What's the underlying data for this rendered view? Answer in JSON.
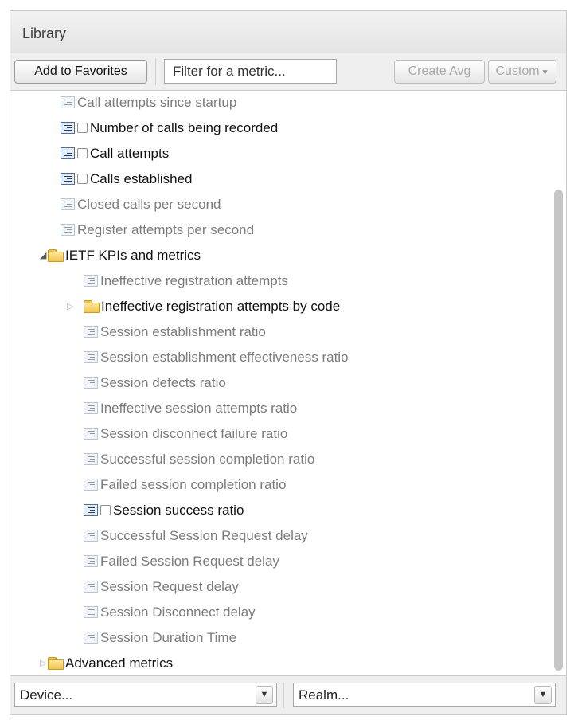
{
  "panel": {
    "title": "Library"
  },
  "toolbar": {
    "add_favorites_label": "Add to Favorites",
    "filter_placeholder": "Filter for a metric...",
    "filter_value": "",
    "create_avg_label": "Create Avg",
    "custom_label": "Custom"
  },
  "tree": {
    "items": [
      {
        "label": "Call attempts since startup",
        "kind": "metric",
        "state": "dim"
      },
      {
        "label": "Number of calls being recorded",
        "kind": "metric",
        "state": "active"
      },
      {
        "label": "Call attempts",
        "kind": "metric",
        "state": "active"
      },
      {
        "label": "Calls established",
        "kind": "metric",
        "state": "active"
      },
      {
        "label": "Closed calls per second",
        "kind": "metric",
        "state": "dim"
      },
      {
        "label": "Register attempts per second",
        "kind": "metric",
        "state": "dim"
      },
      {
        "label": "IETF KPIs and metrics",
        "kind": "folder",
        "expanded": true
      },
      {
        "label": "Ineffective registration attempts",
        "kind": "metric",
        "state": "dim"
      },
      {
        "label": "Ineffective registration attempts by code",
        "kind": "folder",
        "expanded": false
      },
      {
        "label": "Session establishment ratio",
        "kind": "metric",
        "state": "dim"
      },
      {
        "label": "Session establishment effectiveness ratio",
        "kind": "metric",
        "state": "dim"
      },
      {
        "label": "Session defects ratio",
        "kind": "metric",
        "state": "dim"
      },
      {
        "label": "Ineffective session attempts ratio",
        "kind": "metric",
        "state": "dim"
      },
      {
        "label": "Session disconnect failure ratio",
        "kind": "metric",
        "state": "dim"
      },
      {
        "label": "Successful session completion ratio",
        "kind": "metric",
        "state": "dim"
      },
      {
        "label": "Failed session completion ratio",
        "kind": "metric",
        "state": "dim"
      },
      {
        "label": "Session success ratio",
        "kind": "metric",
        "state": "active"
      },
      {
        "label": "Successful Session Request delay",
        "kind": "metric",
        "state": "dim"
      },
      {
        "label": "Failed Session Request delay",
        "kind": "metric",
        "state": "dim"
      },
      {
        "label": "Session Request delay",
        "kind": "metric",
        "state": "dim"
      },
      {
        "label": "Session Disconnect delay",
        "kind": "metric",
        "state": "dim"
      },
      {
        "label": "Session Duration Time",
        "kind": "metric",
        "state": "dim"
      },
      {
        "label": "Advanced metrics",
        "kind": "folder",
        "expanded": false
      }
    ]
  },
  "bottom": {
    "device_value": "Device...",
    "realm_value": "Realm..."
  },
  "icons": {
    "metric": "metric-icon",
    "folder": "folder-icon",
    "expand": "expand-triangle-icon",
    "dropdown": "chevron-down-icon"
  },
  "colors": {
    "active_text": "#111111",
    "dim_text": "#7c7c7c",
    "folder": "#f1c54e"
  }
}
